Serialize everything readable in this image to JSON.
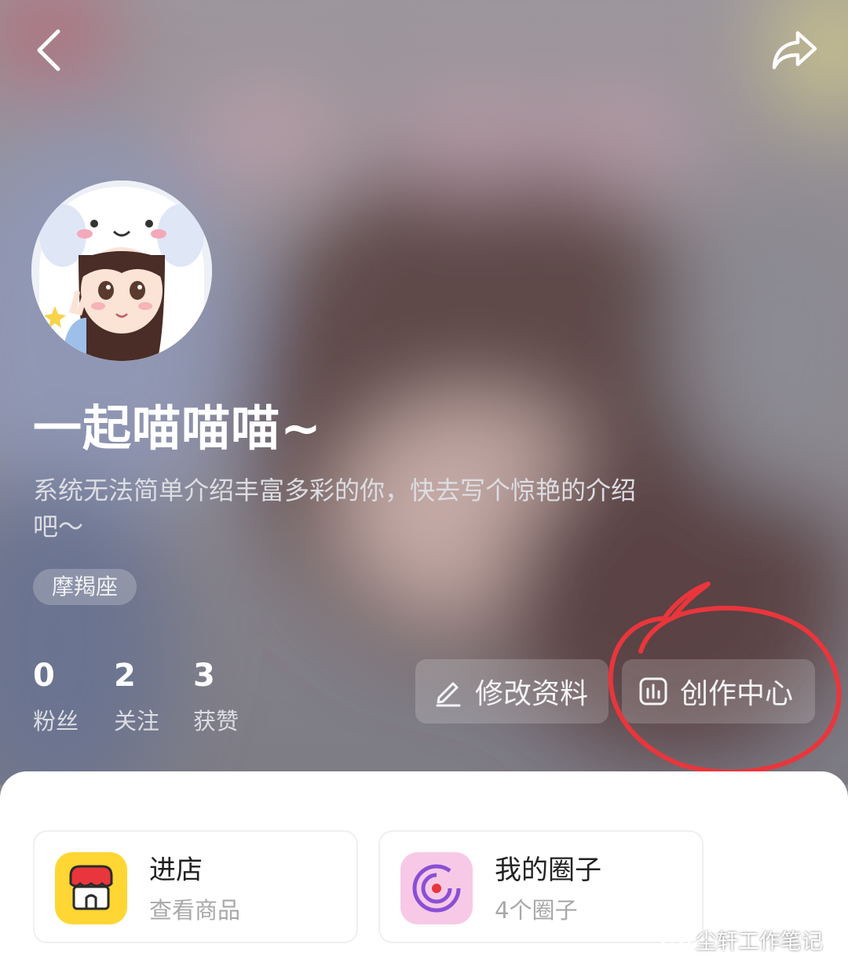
{
  "profile": {
    "nickname": "一起喵喵喵~",
    "bio": "系统无法简单介绍丰富多彩的你，快去写个惊艳的介绍吧～",
    "tag": "摩羯座"
  },
  "stats": [
    {
      "value": "0",
      "label": "粉丝"
    },
    {
      "value": "2",
      "label": "关注"
    },
    {
      "value": "3",
      "label": "获赞"
    }
  ],
  "actions": {
    "edit_label": "修改资料",
    "creator_label": "创作中心"
  },
  "cards": [
    {
      "title": "进店",
      "subtitle": "查看商品",
      "icon": "store-icon"
    },
    {
      "title": "我的圈子",
      "subtitle": "4个圈子",
      "icon": "circle-icon"
    }
  ],
  "watermark": "尘轩工作笔记",
  "icons": {
    "back": "back-arrow-icon",
    "share": "share-icon",
    "edit": "pencil-icon",
    "creator": "chart-icon"
  },
  "colors": {
    "annotation": "#e8363c",
    "store_icon_bg": "#ffd633",
    "circle_icon_bg": "#f7c9e6"
  }
}
